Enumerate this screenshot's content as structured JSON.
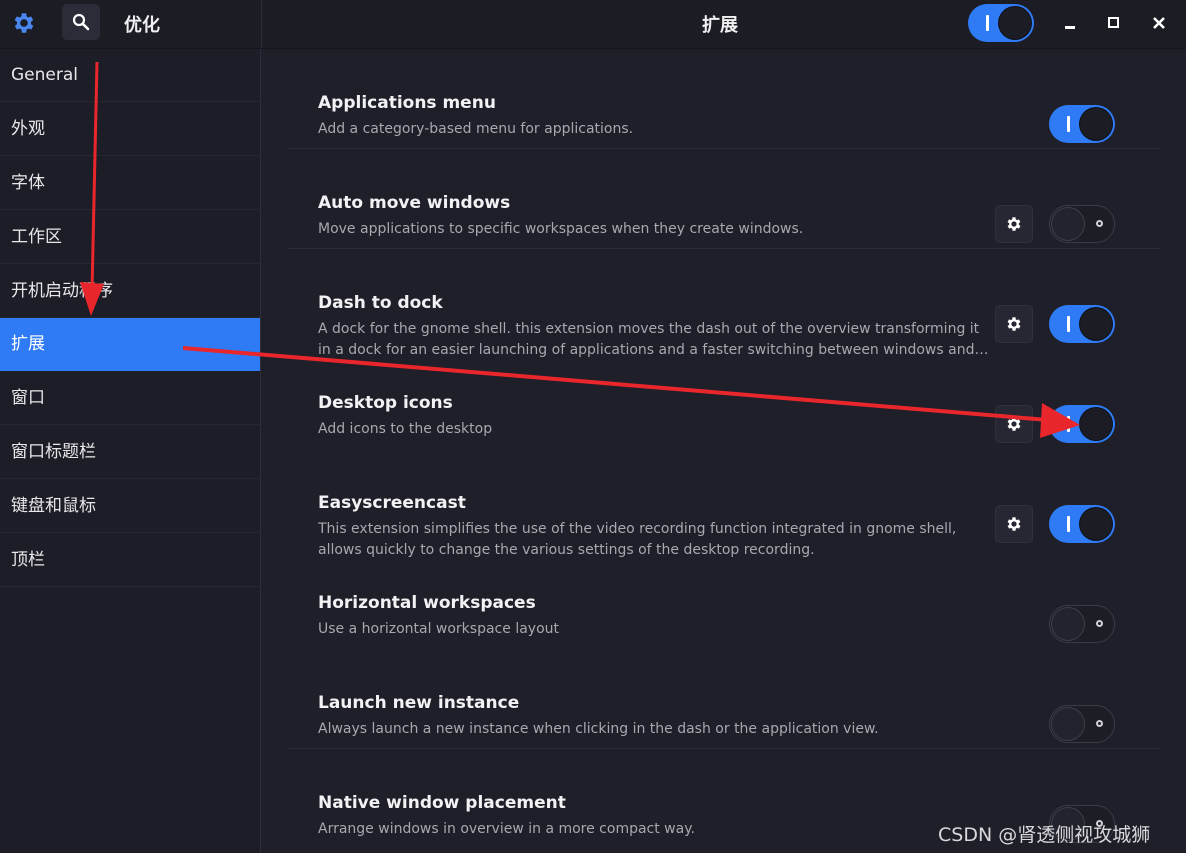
{
  "app_title": "优化",
  "page_title": "扩展",
  "header": {
    "global_switch_on": true,
    "accent_color": "#2f7bf6"
  },
  "sidebar": {
    "items": [
      {
        "label": "General"
      },
      {
        "label": "外观"
      },
      {
        "label": "字体"
      },
      {
        "label": "工作区"
      },
      {
        "label": "开机启动程序"
      },
      {
        "label": "扩展",
        "selected": true
      },
      {
        "label": "窗口"
      },
      {
        "label": "窗口标题栏"
      },
      {
        "label": "键盘和鼠标"
      },
      {
        "label": "顶栏"
      }
    ]
  },
  "extensions": [
    {
      "title": "Applications menu",
      "desc": "Add a category-based menu for applications.",
      "has_settings": false,
      "enabled": true
    },
    {
      "title": "Auto move windows",
      "desc": "Move applications to specific workspaces when they create windows.",
      "has_settings": true,
      "enabled": false
    },
    {
      "title": "Dash to dock",
      "desc": "A dock for the gnome shell. this extension moves the dash out of the overview transforming it",
      "desc2": "in a dock for an easier launching of applications and a faster switching between windows and…",
      "has_settings": true,
      "enabled": true
    },
    {
      "title": "Desktop icons",
      "desc": "Add icons to the desktop",
      "has_settings": true,
      "enabled": true
    },
    {
      "title": "Easyscreencast",
      "desc": "This extension simplifies the use of the video recording function integrated in gnome shell,",
      "desc2": "allows quickly to change the various settings of the desktop recording.",
      "has_settings": true,
      "enabled": true
    },
    {
      "title": "Horizontal workspaces",
      "desc": "Use a horizontal workspace layout",
      "has_settings": false,
      "enabled": false
    },
    {
      "title": "Launch new instance",
      "desc": "Always launch a new instance when clicking in the dash or the application view.",
      "has_settings": false,
      "enabled": false
    },
    {
      "title": "Native window placement",
      "desc": "Arrange windows in overview in a more compact way.",
      "has_settings": false,
      "enabled": false
    }
  ],
  "watermark": "CSDN @肾透侧视攻城狮",
  "annotation_color": "#e8262b"
}
